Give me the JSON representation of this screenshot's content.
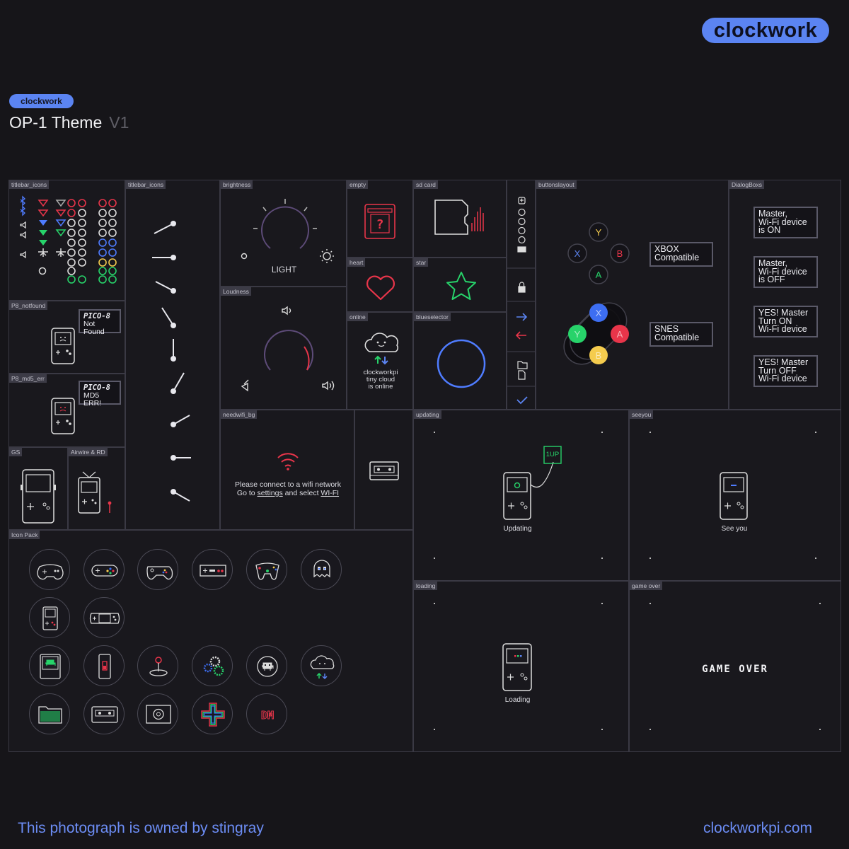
{
  "brand": {
    "logo": "clockwork",
    "mini_logo": "clockwork",
    "site": "clockworkpi.com"
  },
  "header": {
    "title": "OP-1 Theme",
    "version": "V1"
  },
  "footer": {
    "credit": "This photograph is owned by stingray"
  },
  "colors": {
    "background": "#161519",
    "accent": "#5b84f2",
    "panel_border": "#3a3944",
    "red": "#e8354a",
    "green": "#27d36a",
    "yellow": "#f5cc4e",
    "blue": "#3d6ef2"
  },
  "panels": {
    "titlebar_icons_1": "titlebar_icons",
    "titlebar_icons_2": "titlebar_icons",
    "brightness": "brightness",
    "empty": "empty",
    "sd_card": "sd card",
    "buttonslayout": "buttonslayout",
    "dialogboxes": "DialogBoxs",
    "heart": "heart",
    "star": "star",
    "online": "online",
    "blueselector": "blueselector",
    "loudness": "Loudness",
    "p8_notfound": "P8_notfound",
    "p8_md5_err": "P8_md5_err",
    "gs": "GS",
    "airwire": "Airwire & RD",
    "needwifi_bg": "needwifi_bg",
    "updating": "updating",
    "seeyou": "seeyou",
    "icon_pack": "Icon Pack",
    "loading": "loading",
    "game_over": "game over"
  },
  "brightness": {
    "label": "LIGHT"
  },
  "pico": {
    "logo": "PICO-8",
    "notfound": "Not Found",
    "md5": "MD5 ERR!"
  },
  "online": {
    "line1": "clockworkpi",
    "line2": "tiny cloud",
    "line3": "is online"
  },
  "needwifi": {
    "line1": "Please connect to a wifi network",
    "line2_pre": "Go to ",
    "settings": "settings",
    "line2_mid": " and select ",
    "wifi": "WI-FI"
  },
  "buttons": {
    "xbox": {
      "label1": "XBOX",
      "label2": "Compatible",
      "keys": [
        "Y",
        "X",
        "B",
        "A"
      ]
    },
    "snes": {
      "label1": "SNES",
      "label2": "Compatible",
      "keys": [
        "X",
        "Y",
        "A",
        "B"
      ]
    }
  },
  "dialogs": [
    {
      "l1": "Master,",
      "l2": "Wi-Fi device",
      "l3": "is ON"
    },
    {
      "l1": "Master,",
      "l2": "Wi-Fi device",
      "l3": "is OFF"
    },
    {
      "l1": "YES! Master",
      "l2": "Turn ON",
      "l3": "Wi-Fi device"
    },
    {
      "l1": "YES! Master",
      "l2": "Turn OFF",
      "l3": "Wi-Fi device"
    }
  ],
  "updating": {
    "label": "Updating",
    "badge": "1UP"
  },
  "seeyou": {
    "label": "See you"
  },
  "loading": {
    "label": "Loading"
  },
  "gameover": {
    "label": "GAME OVER"
  },
  "strip_icons": [
    "plus-icon",
    "x-circle-icon",
    "y-circle-icon",
    "a-circle-icon",
    "b-circle-icon",
    "lock-icon",
    "arrow-right-icon",
    "arrow-left-icon",
    "folder-icon",
    "file-icon",
    "check-icon"
  ],
  "icon_pack": [
    "sega-pad-icon",
    "snes-pad-icon",
    "xbox-pad-icon",
    "nes-pad-icon",
    "n64-pad-icon",
    "ghost-icon",
    "gameboy-icon",
    "gba-icon",
    "invader-console-icon",
    "phone-icon",
    "joystick-icon",
    "gears-icon",
    "invader-icon",
    "cloud-icon",
    "folder-icon",
    "cassette-icon",
    "camera-icon",
    "dpad-icon",
    "doom-icon"
  ]
}
